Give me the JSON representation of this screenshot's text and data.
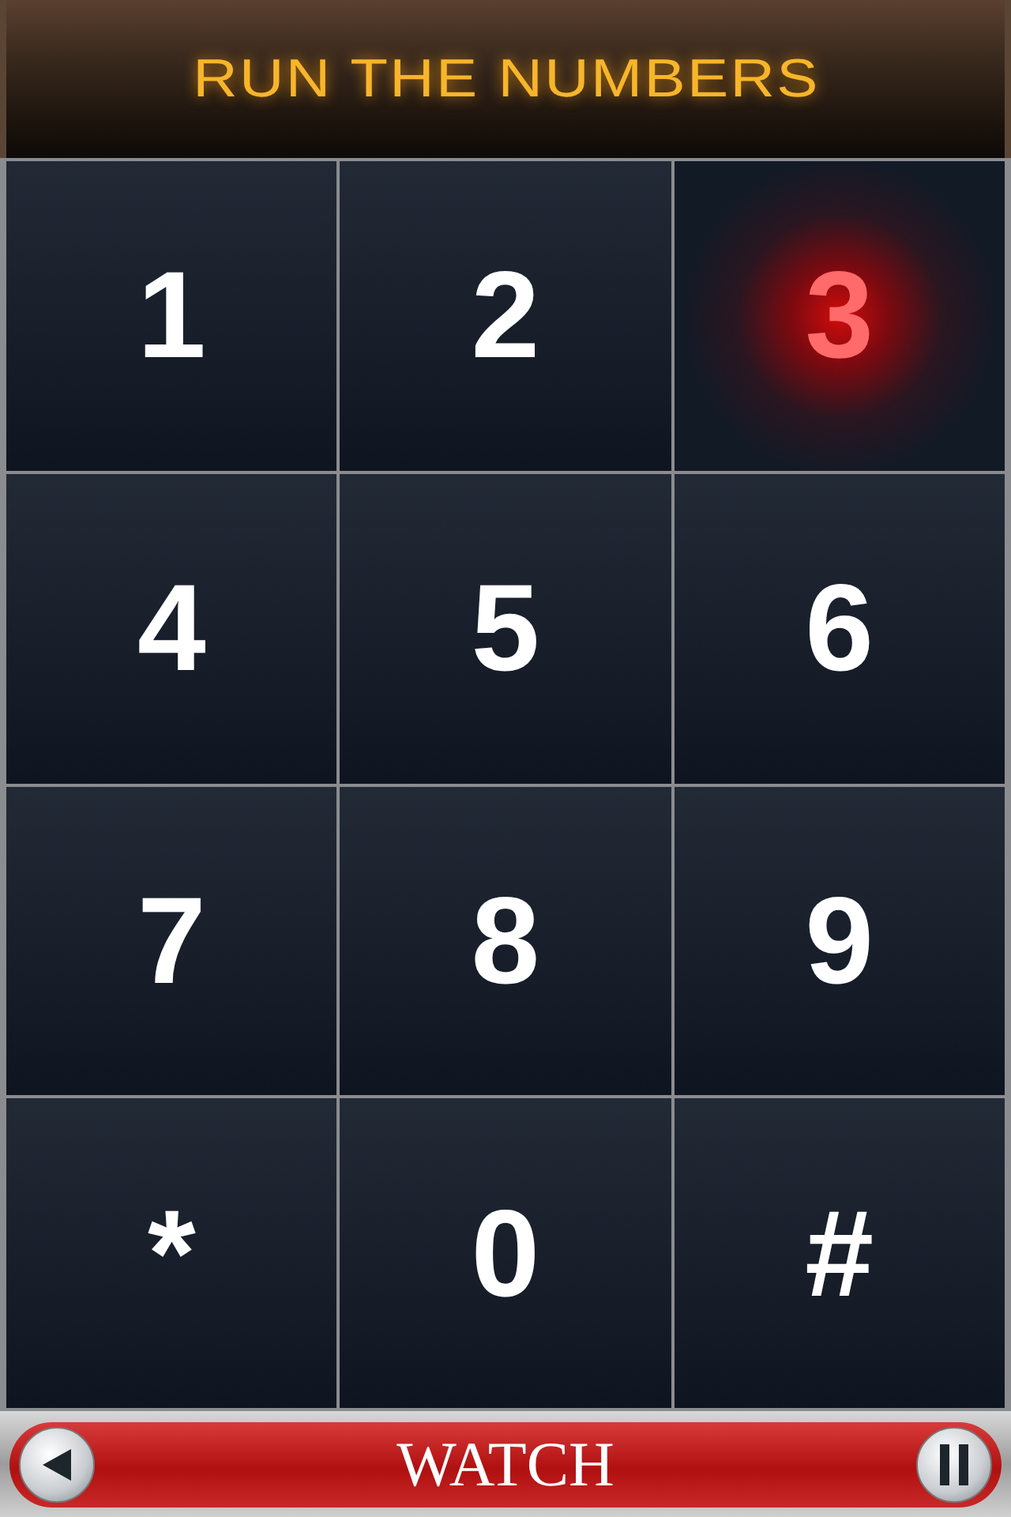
{
  "header": {
    "title": "RUN THE NUMBERS"
  },
  "keypad": [
    {
      "label": "1",
      "lit": false
    },
    {
      "label": "2",
      "lit": false
    },
    {
      "label": "3",
      "lit": true
    },
    {
      "label": "4",
      "lit": false
    },
    {
      "label": "5",
      "lit": false
    },
    {
      "label": "6",
      "lit": false
    },
    {
      "label": "7",
      "lit": false
    },
    {
      "label": "8",
      "lit": false
    },
    {
      "label": "9",
      "lit": false
    },
    {
      "label": "*",
      "lit": false
    },
    {
      "label": "0",
      "lit": false
    },
    {
      "label": "#",
      "lit": false
    }
  ],
  "bottom_bar": {
    "label": "WATCH"
  }
}
